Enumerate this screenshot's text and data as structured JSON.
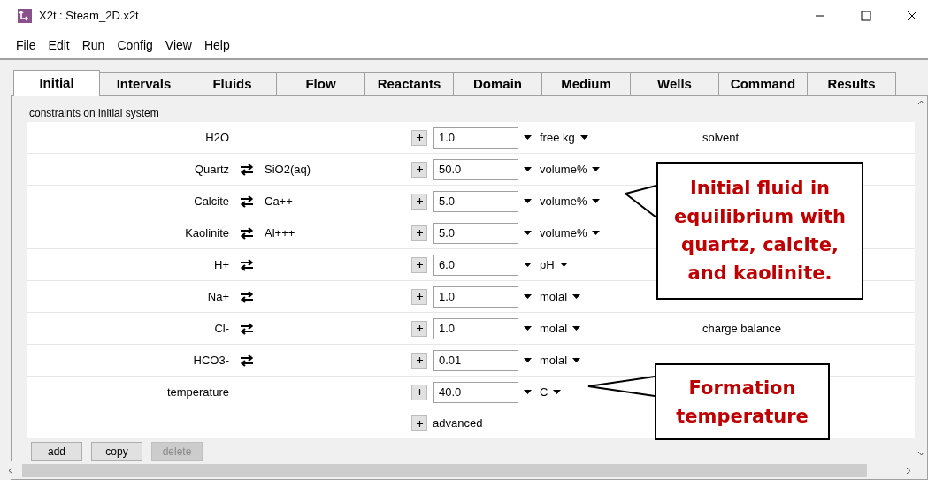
{
  "window": {
    "title": "X2t : Steam_2D.x2t"
  },
  "menu": [
    "File",
    "Edit",
    "Run",
    "Config",
    "View",
    "Help"
  ],
  "tabs": [
    {
      "label": "Initial",
      "selected": true
    },
    {
      "label": "Intervals",
      "selected": false
    },
    {
      "label": "Fluids",
      "selected": false
    },
    {
      "label": "Flow",
      "selected": false
    },
    {
      "label": "Reactants",
      "selected": false
    },
    {
      "label": "Domain",
      "selected": false
    },
    {
      "label": "Medium",
      "selected": false
    },
    {
      "label": "Wells",
      "selected": false
    },
    {
      "label": "Command",
      "selected": false
    },
    {
      "label": "Results",
      "selected": false
    }
  ],
  "group_title": "constraints on initial system",
  "rows": [
    {
      "name": "H2O",
      "swap": false,
      "species": "",
      "value": "1.0",
      "unit": "free kg",
      "note": "solvent"
    },
    {
      "name": "Quartz",
      "swap": true,
      "species": "SiO2(aq)",
      "value": "50.0",
      "unit": "volume%",
      "note": ""
    },
    {
      "name": "Calcite",
      "swap": true,
      "species": "Ca++",
      "value": "5.0",
      "unit": "volume%",
      "note": ""
    },
    {
      "name": "Kaolinite",
      "swap": true,
      "species": "Al+++",
      "value": "5.0",
      "unit": "volume%",
      "note": ""
    },
    {
      "name": "H+",
      "swap": true,
      "species": "",
      "value": "6.0",
      "unit": "pH",
      "note": ""
    },
    {
      "name": "Na+",
      "swap": true,
      "species": "",
      "value": "1.0",
      "unit": "molal",
      "note": ""
    },
    {
      "name": "Cl-",
      "swap": true,
      "species": "",
      "value": "1.0",
      "unit": "molal",
      "note": "charge balance"
    },
    {
      "name": "HCO3-",
      "swap": true,
      "species": "",
      "value": "0.01",
      "unit": "molal",
      "note": ""
    },
    {
      "name": "temperature",
      "swap": false,
      "species": "",
      "value": "40.0",
      "unit": "C",
      "note": ""
    }
  ],
  "advanced": {
    "label": "advanced"
  },
  "buttons": [
    {
      "label": "add",
      "disabled": false
    },
    {
      "label": "copy",
      "disabled": false
    },
    {
      "label": "delete",
      "disabled": true
    }
  ],
  "callouts": [
    "Initial fluid in equilibrium with quartz, calcite, and kaolinite.",
    "Formation temperature"
  ]
}
